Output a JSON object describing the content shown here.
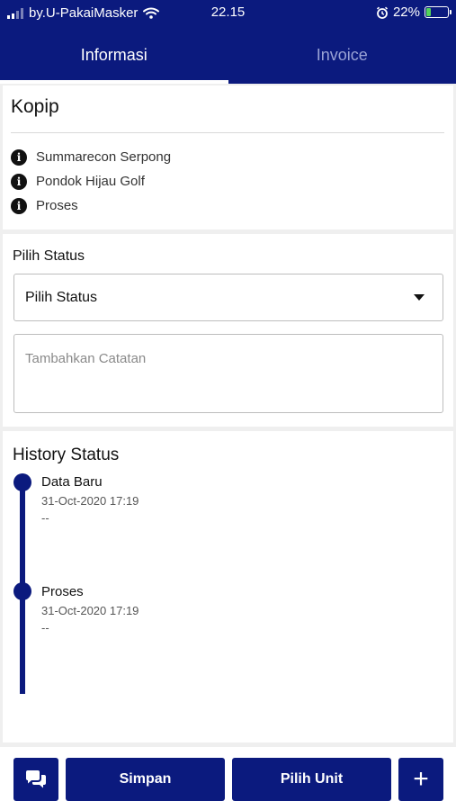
{
  "status_bar": {
    "carrier": "by.U-PakaiMasker",
    "time": "22.15",
    "battery_percent": "22%",
    "battery_level": 0.22,
    "icons": [
      "signal-icon",
      "wifi-icon",
      "alarm-icon",
      "battery-icon"
    ]
  },
  "tabs": [
    {
      "label": "Informasi",
      "active": true
    },
    {
      "label": "Invoice",
      "active": false
    }
  ],
  "info": {
    "title": "Kopip",
    "items": [
      {
        "icon": "info-icon",
        "text": "Summarecon Serpong"
      },
      {
        "icon": "info-icon",
        "text": "Pondok Hijau Golf"
      },
      {
        "icon": "info-icon",
        "text": "Proses"
      }
    ]
  },
  "status_form": {
    "label": "Pilih Status",
    "select_value": "Pilih Status",
    "notes_placeholder": "Tambahkan Catatan"
  },
  "history": {
    "title": "History Status",
    "items": [
      {
        "status": "Data Baru",
        "date": "31-Oct-2020 17:19",
        "note": "--"
      },
      {
        "status": "Proses",
        "date": "31-Oct-2020 17:19",
        "note": "--"
      }
    ]
  },
  "actions": {
    "chat_icon": "chat-icon",
    "save_label": "Simpan",
    "unit_label": "Pilih Unit",
    "add_label": "+"
  },
  "colors": {
    "primary": "#0b1a7e",
    "background": "#efefef",
    "card": "#ffffff",
    "battery": "#53d35a"
  }
}
